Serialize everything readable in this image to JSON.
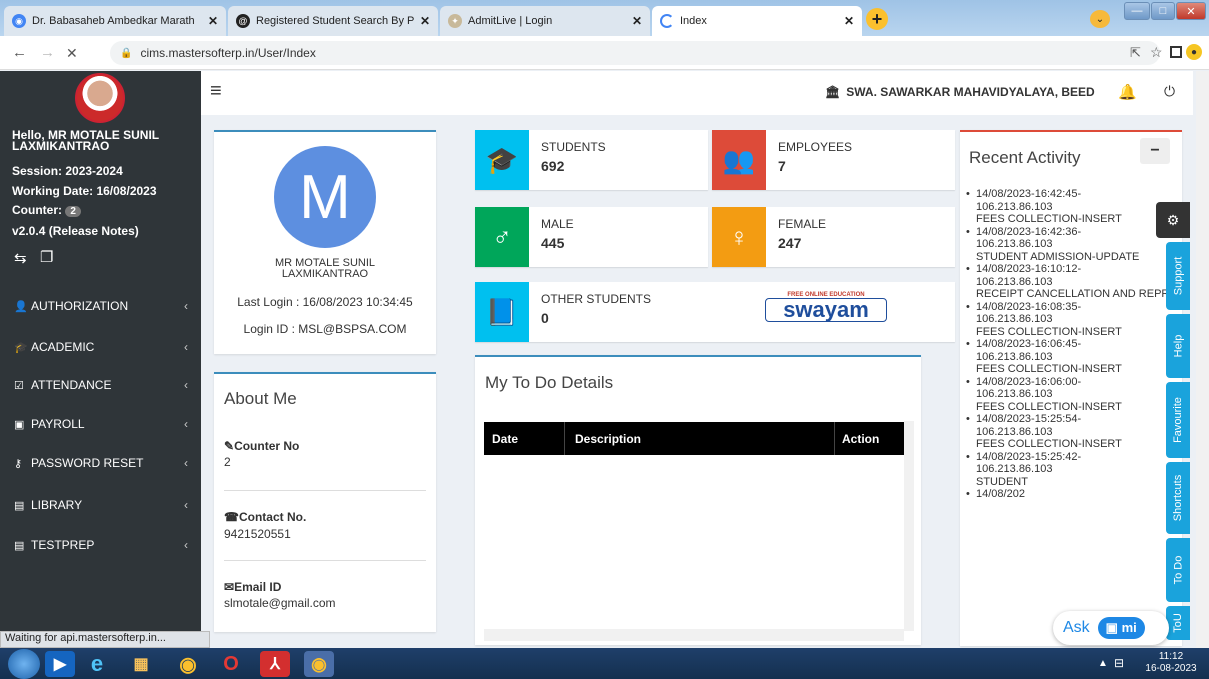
{
  "browser": {
    "tabs": [
      {
        "label": "Dr. Babasaheb Ambedkar Marath",
        "icon": "chrome-tab-icon"
      },
      {
        "label": "Registered Student Search By PR",
        "icon": "circle-a-icon"
      },
      {
        "label": "AdmitLive | Login",
        "icon": "admitlive-icon"
      },
      {
        "label": "Index",
        "icon": "loading-icon"
      }
    ],
    "url": "cims.mastersofterp.in/User/Index",
    "status": "Waiting for api.mastersofterp.in..."
  },
  "sidebar": {
    "greeting": "Hello, MR MOTALE SUNIL LAXMIKANTRAO",
    "session": "Session: 2023-2024",
    "working_date": "Working Date: 16/08/2023",
    "counter_label": "Counter:",
    "counter_value": "2",
    "version": "v2.0.4 (Release Notes)",
    "menu": [
      {
        "label": "AUTHORIZATION",
        "icon": "user-plus-icon"
      },
      {
        "label": "ACADEMIC",
        "icon": "graduation-cap-icon"
      },
      {
        "label": "ATTENDANCE",
        "icon": "checkbox-icon"
      },
      {
        "label": "PAYROLL",
        "icon": "money-icon"
      },
      {
        "label": "PASSWORD RESET",
        "icon": "key-icon"
      },
      {
        "label": "LIBRARY",
        "icon": "book-icon"
      },
      {
        "label": "TESTPREP",
        "icon": "test-icon"
      }
    ]
  },
  "header": {
    "college": "SWA. SAWARKAR MAHAVIDYALAYA, BEED"
  },
  "profile": {
    "initial": "M",
    "name": "MR MOTALE SUNIL LAXMIKANTRAO",
    "last_login": "Last Login : 16/08/2023 10:34:45",
    "login_id": "Login ID : MSL@BSPSA.COM"
  },
  "about": {
    "title": "About Me",
    "counter_label": "Counter No",
    "counter_value": "2",
    "contact_label": "Contact No.",
    "contact_value": "9421520551",
    "email_label": "Email ID",
    "email_value": "slmotale@gmail.com"
  },
  "stats": [
    {
      "label": "STUDENTS",
      "value": "692",
      "color": "#00c0ef"
    },
    {
      "label": "EMPLOYEES",
      "value": "7",
      "color": "#dd4b39"
    },
    {
      "label": "MALE",
      "value": "445",
      "color": "#00a65a"
    },
    {
      "label": "FEMALE",
      "value": "247",
      "color": "#f39c12"
    },
    {
      "label": "OTHER STUDENTS",
      "value": "0",
      "color": "#00c0ef"
    }
  ],
  "swayam": {
    "top": "FREE ONLINE EDUCATION",
    "name": "swayam"
  },
  "todo": {
    "title": "My To Do Details",
    "columns": [
      "Date",
      "Description",
      "Action"
    ]
  },
  "activity": {
    "title": "Recent Activity",
    "items": [
      {
        "time": "14/08/2023-16:42:45-",
        "ip": "106.213.86.103",
        "action": "FEES COLLECTION-INSERT"
      },
      {
        "time": "14/08/2023-16:42:36-",
        "ip": "106.213.86.103",
        "action": "STUDENT ADMISSION-UPDATE"
      },
      {
        "time": "14/08/2023-16:10:12-",
        "ip": "106.213.86.103",
        "action": "RECEIPT CANCELLATION AND REPRINT-UPDATE"
      },
      {
        "time": "14/08/2023-16:08:35-",
        "ip": "106.213.86.103",
        "action": "FEES COLLECTION-INSERT"
      },
      {
        "time": "14/08/2023-16:06:45-",
        "ip": "106.213.86.103",
        "action": "FEES COLLECTION-INSERT"
      },
      {
        "time": "14/08/2023-16:06:00-",
        "ip": "106.213.86.103",
        "action": "FEES COLLECTION-INSERT"
      },
      {
        "time": "14/08/2023-15:25:54-",
        "ip": "106.213.86.103",
        "action": "FEES COLLECTION-INSERT"
      },
      {
        "time": "14/08/2023-15:25:42-",
        "ip": "106.213.86.103",
        "action": "STUDENT"
      },
      {
        "time": "14/08/202",
        "ip": "",
        "action": ""
      }
    ]
  },
  "sidetabs": [
    "Support",
    "Help",
    "Favourite",
    "Shortcuts",
    "To Do",
    "ToU"
  ],
  "ask": {
    "label": "Ask",
    "brand": "mi"
  },
  "taskbar": {
    "time": "11:12",
    "date": "16-08-2023"
  }
}
